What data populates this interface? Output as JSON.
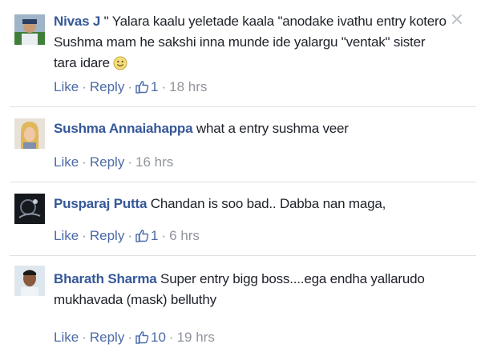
{
  "comments": [
    {
      "author": "Nivas J",
      "text": " \" Yalara kaalu yeletade kaala \"anodake ivathu entry kotero Sushma mam he sakshi inna munde ide yalargu \"ventak\" sister tara idare",
      "emoji": "smiley-emoji",
      "actions": {
        "like": "Like",
        "reply": "Reply",
        "likes": "1",
        "time": "18 hrs"
      }
    },
    {
      "author": "Sushma Annaiahappa",
      "text": " what a entry sushma veer",
      "actions": {
        "like": "Like",
        "reply": "Reply",
        "likes": "",
        "time": "16 hrs"
      }
    },
    {
      "author": "Pusparaj Putta",
      "text": " Chandan is soo bad.. Dabba nan maga,",
      "actions": {
        "like": "Like",
        "reply": "Reply",
        "likes": "1",
        "time": "6 hrs"
      }
    },
    {
      "author": "Bharath Sharma",
      "text": " Super entry bigg boss....ega endha yallarudo mukhavada (mask) belluthy",
      "actions": {
        "like": "Like",
        "reply": "Reply",
        "likes": "10",
        "time": "19 hrs"
      }
    }
  ],
  "separator": "·",
  "icons": {
    "like": "thumbs-up-icon",
    "close": "close-icon"
  },
  "colors": {
    "author": "#365899",
    "link": "#4b6aa8",
    "meta": "#90949c",
    "text": "#1d2129",
    "divider": "#dfe1e6"
  }
}
